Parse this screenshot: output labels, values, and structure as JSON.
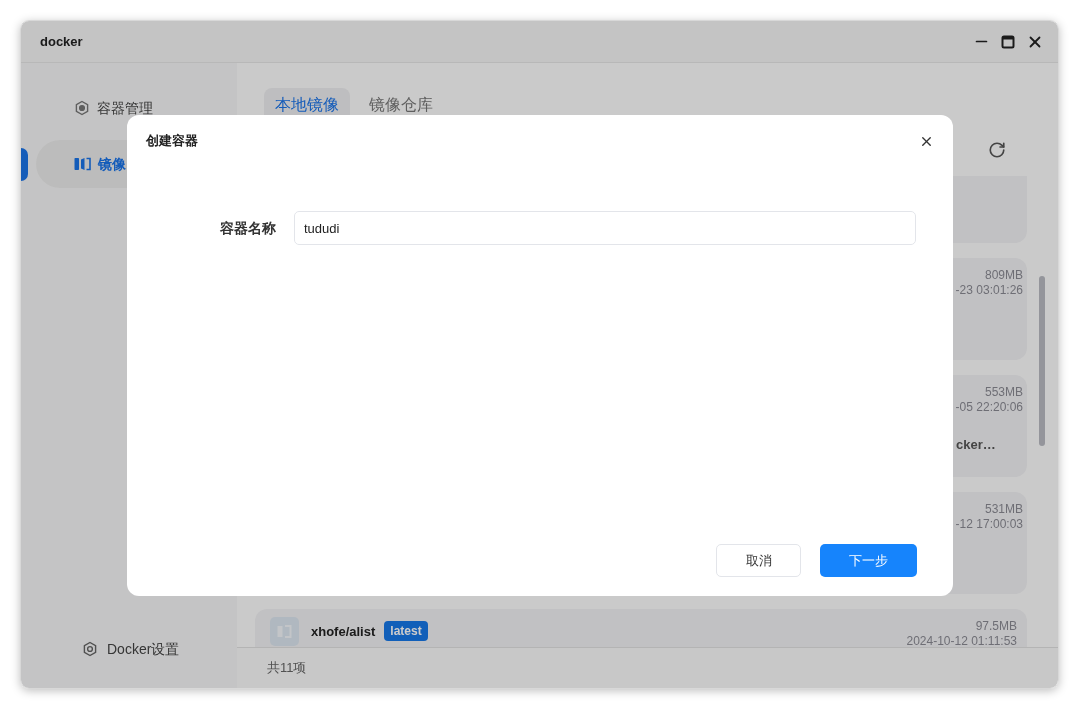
{
  "window": {
    "title": "docker"
  },
  "sidebar": {
    "items": [
      {
        "label": "容器管理",
        "kind": "containers",
        "selected": false
      },
      {
        "label": "镜像",
        "kind": "images",
        "selected": true
      }
    ],
    "footer_item": {
      "label": "Docker设置"
    }
  },
  "tabs": [
    {
      "label": "本地镜像",
      "selected": true
    },
    {
      "label": "镜像仓库",
      "selected": false
    }
  ],
  "images": [
    {
      "kind": "cut"
    },
    {
      "kind": "full",
      "size": "809MB",
      "date": "-23 03:01:26"
    },
    {
      "kind": "full",
      "size": "553MB",
      "date": "-05 22:20:06",
      "name": "cker…"
    },
    {
      "kind": "full",
      "size": "531MB",
      "date": "-12 17:00:03"
    },
    {
      "kind": "named",
      "name": "xhofe/alist",
      "tag": "latest",
      "size": "97.5MB",
      "date": "2024-10-12 01:11:53"
    }
  ],
  "footer": {
    "count": "共11项"
  },
  "dialog": {
    "title": "创建容器",
    "fields": [
      {
        "label": "容器名称",
        "value": "tududi"
      }
    ],
    "buttons": [
      {
        "label": "取消",
        "kind": "secondary"
      },
      {
        "label": "下一步",
        "kind": "primary"
      }
    ]
  }
}
